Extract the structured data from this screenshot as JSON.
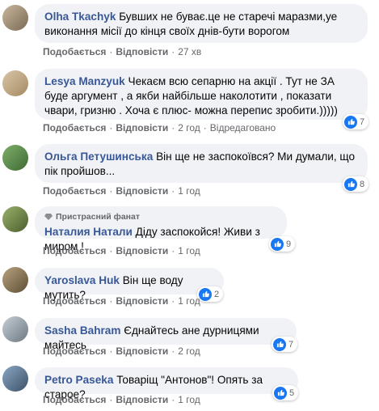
{
  "colors": {
    "author": "#385898",
    "bubble": "#f0f2f5",
    "meta": "#65676b",
    "like": "#1877f2"
  },
  "comments": [
    {
      "author": "Olha Tkachyk",
      "text": "Бувших не буває.це не старечі маразми,уе виконання місії до кінця своїх днів-бути ворогом",
      "like": "Подобається",
      "reply": "Відповісти",
      "time": "27 хв"
    },
    {
      "author": "Lesya Manzyuk",
      "text": "Чекаєм всю сепарню на акції . Тут не ЗА буде аргумент , а якби найбільше наколотити , показати чвари, гризню . Хоча є плюс- можна перепис зробити.)))))",
      "like": "Подобається",
      "reply": "Відповісти",
      "time": "2 год",
      "edited": "Відредаговано",
      "reactions": "7"
    },
    {
      "author": "Ольга Петушинська",
      "text": "Він ще не заспокоївся? Ми думали, що пік пройшов...",
      "like": "Подобається",
      "reply": "Відповісти",
      "time": "1 год",
      "reactions": "8"
    },
    {
      "badge": "Пристрасний фанат",
      "author": "Наталия Натали",
      "text": "Діду заспокойся! Живи з миром !",
      "like": "Подобається",
      "reply": "Відповісти",
      "time": "1 год",
      "reactions": "9"
    },
    {
      "author": "Yaroslava Huk",
      "text": "Він ще воду мутить?",
      "like": "Подобається",
      "reply": "Відповісти",
      "time": "1 год",
      "reactions": "2"
    },
    {
      "author": "Sasha Bahram",
      "text": "Єднайтесь ане дурницями майтесь",
      "like": "Подобається",
      "reply": "Відповісти",
      "time": "2 год",
      "reactions": "7"
    },
    {
      "author": "Petro Paseka",
      "text": "Товаріщ \"Антонов\"! Опять за старое?",
      "like": "Подобається",
      "reply": "Відповісти",
      "time": "1 год",
      "reactions": "5"
    }
  ]
}
